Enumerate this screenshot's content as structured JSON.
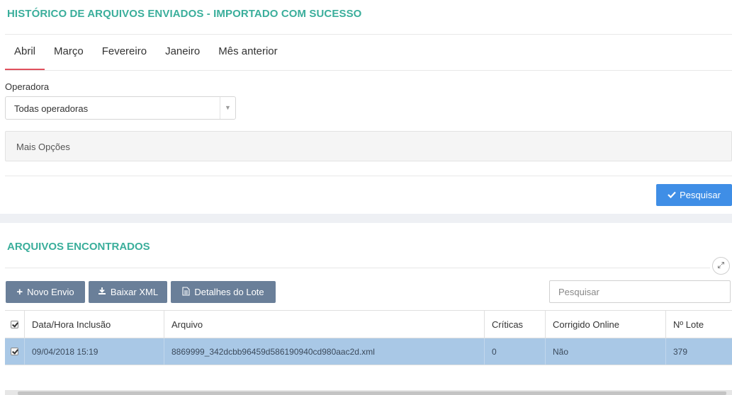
{
  "page_title": "HISTÓRICO DE ARQUIVOS ENVIADOS - IMPORTADO COM SUCESSO",
  "tabs": [
    {
      "label": "Abril",
      "active": true
    },
    {
      "label": "Março",
      "active": false
    },
    {
      "label": "Fevereiro",
      "active": false
    },
    {
      "label": "Janeiro",
      "active": false
    },
    {
      "label": "Mês anterior",
      "active": false
    }
  ],
  "filters": {
    "operadora_label": "Operadora",
    "operadora_value": "Todas operadoras",
    "mais_opcoes": "Mais Opções",
    "search_button": "Pesquisar"
  },
  "results": {
    "title": "ARQUIVOS ENCONTRADOS",
    "toolbar": {
      "novo_envio": "Novo Envio",
      "baixar_xml": "Baixar XML",
      "detalhes_lote": "Detalhes do Lote",
      "search_placeholder": "Pesquisar"
    },
    "columns": [
      "Data/Hora Inclusão",
      "Arquivo",
      "Críticas",
      "Corrigido Online",
      "Nº Lote"
    ],
    "rows": [
      {
        "checked": true,
        "data_hora": "09/04/2018 15:19",
        "arquivo": "8869999_342dcbb96459d586190940cd980aac2d.xml",
        "criticas": "0",
        "corrigido_online": "Não",
        "lote": "379"
      }
    ]
  },
  "colors": {
    "accent_teal": "#3aae9b",
    "active_tab_underline": "#e0505d",
    "primary_button": "#3f8ee6",
    "toolbar_button": "#6a7f99",
    "selected_row": "#a9c8e6"
  }
}
